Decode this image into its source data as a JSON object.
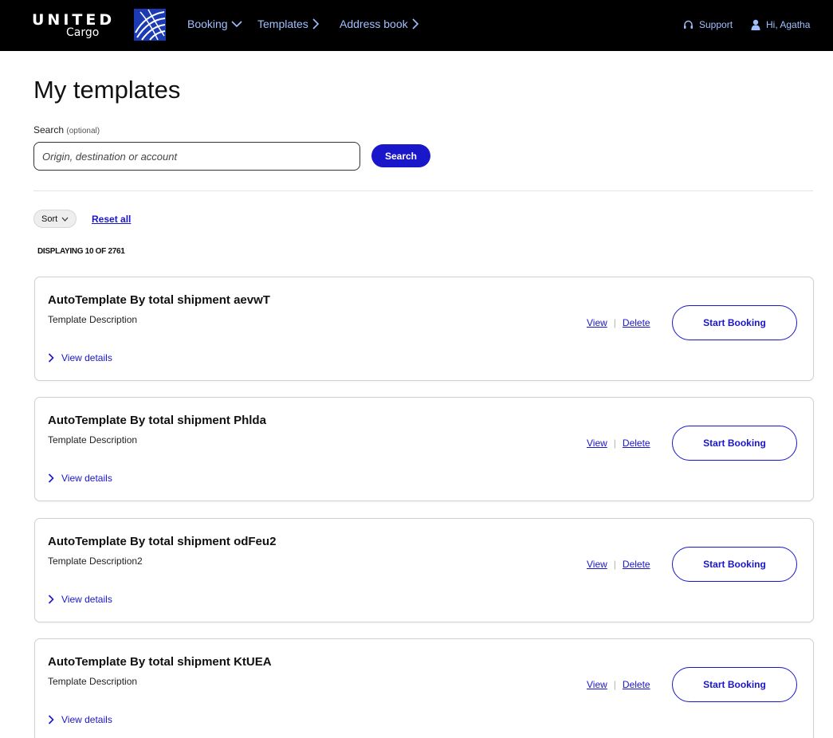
{
  "header": {
    "logo_line1": "UNITED",
    "logo_line2": "Cargo",
    "nav": [
      {
        "label": "Booking",
        "chevron": "chevron-down-icon"
      },
      {
        "label": "Templates",
        "chevron": "chevron-right-icon"
      },
      {
        "label": "Address book",
        "chevron": "chevron-right-icon"
      }
    ],
    "support_label": "Support",
    "user_label": "Hi, Agatha",
    "bg_color": "#000000",
    "link_color": "#9fc0ff"
  },
  "page": {
    "title": "My templates"
  },
  "search": {
    "label": "Search",
    "optional": "(optional)",
    "placeholder": "Origin, destination or account",
    "value": "",
    "button_label": "Search"
  },
  "filters": {
    "sort_label": "Sort",
    "reset_label": "Reset all"
  },
  "results": {
    "displaying": "DISPLAYING 10 OF 2761"
  },
  "cards": [
    {
      "title": "AutoTemplate By total shipment aevwT",
      "description": "Template Description",
      "view": "View",
      "separator": "|",
      "delete": "Delete",
      "start": "Start Booking",
      "details": "View details"
    },
    {
      "title": "AutoTemplate By total shipment Phlda",
      "description": "Template Description",
      "view": "View",
      "separator": "|",
      "delete": "Delete",
      "start": "Start Booking",
      "details": "View details"
    },
    {
      "title": "AutoTemplate By total shipment odFeu2",
      "description": "Template Description2",
      "view": "View",
      "separator": "|",
      "delete": "Delete",
      "start": "Start Booking",
      "details": "View details"
    },
    {
      "title": "AutoTemplate By total shipment KtUEA",
      "description": "Template Description",
      "view": "View",
      "separator": "|",
      "delete": "Delete",
      "start": "Start Booking",
      "details": "View details"
    }
  ],
  "colors": {
    "accent": "#1a16c9",
    "border": "#d0d0d0"
  }
}
